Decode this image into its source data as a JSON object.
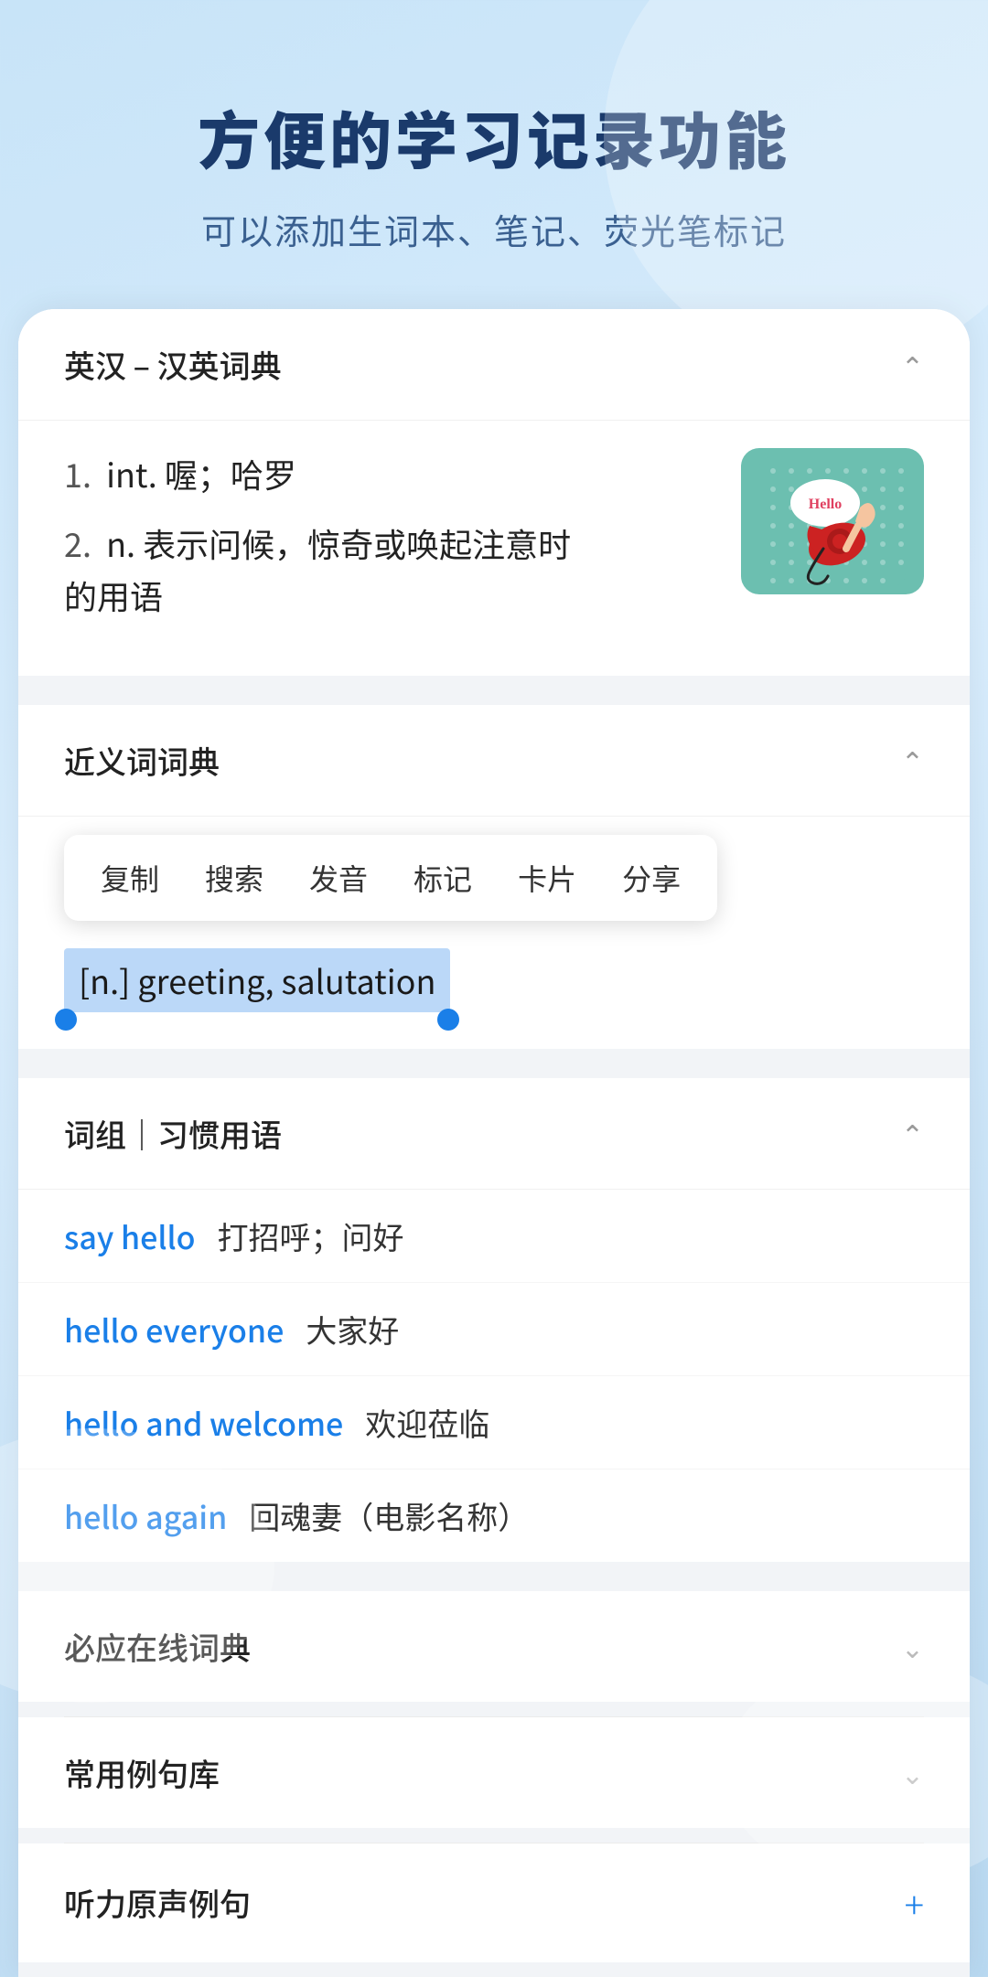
{
  "header": {
    "title": "方便的学习记录功能",
    "subtitle": "可以添加生词本、笔记、荧光笔标记"
  },
  "sections": {
    "eng_han": {
      "title": "英汉 – 汉英词典",
      "definitions": [
        {
          "num": "1.",
          "pos": "int.",
          "meaning": "喔；哈罗"
        },
        {
          "num": "2.",
          "pos": "n.",
          "meaning": "表示问候，惊奇或唤起注意时的用语"
        }
      ]
    },
    "synonym": {
      "title": "近义词词典",
      "content": "[n.] greeting, salutation"
    },
    "context_menu": {
      "items": [
        "复制",
        "搜索",
        "发音",
        "标记",
        "卡片",
        "分享"
      ]
    },
    "phrases": {
      "title": "词组｜习惯用语",
      "items": [
        {
          "english": "say hello",
          "chinese": "打招呼；问好"
        },
        {
          "english": "hello everyone",
          "chinese": "大家好"
        },
        {
          "english": "hello and welcome",
          "chinese": "欢迎莅临"
        },
        {
          "english": "hello again",
          "chinese": "回魂妻（电影名称）"
        }
      ]
    },
    "biyingzaixian": {
      "title": "必应在线词典"
    },
    "changyongliju": {
      "title": "常用例句库"
    },
    "tingli": {
      "title": "听力原声例句"
    }
  }
}
